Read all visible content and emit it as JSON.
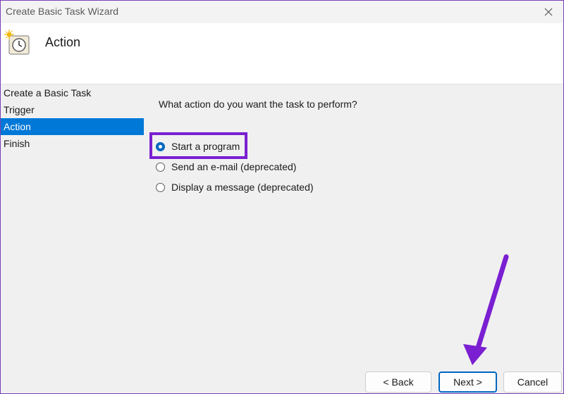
{
  "window": {
    "title": "Create Basic Task Wizard",
    "close_icon": "close-icon"
  },
  "header": {
    "icon": "task-scheduler-clock-icon",
    "title": "Action"
  },
  "sidebar": {
    "items": [
      {
        "label": "Create a Basic Task",
        "active": false
      },
      {
        "label": "Trigger",
        "active": false
      },
      {
        "label": "Action",
        "active": true
      },
      {
        "label": "Finish",
        "active": false
      }
    ]
  },
  "main": {
    "question": "What action do you want the task to perform?",
    "options": [
      {
        "label": "Start a program",
        "checked": true
      },
      {
        "label": "Send an e-mail (deprecated)",
        "checked": false
      },
      {
        "label": "Display a message (deprecated)",
        "checked": false
      }
    ]
  },
  "footer": {
    "back_label": "< Back",
    "next_label": "Next >",
    "cancel_label": "Cancel"
  },
  "colors": {
    "accent": "#0078d7",
    "annotation": "#7a1fd1"
  }
}
